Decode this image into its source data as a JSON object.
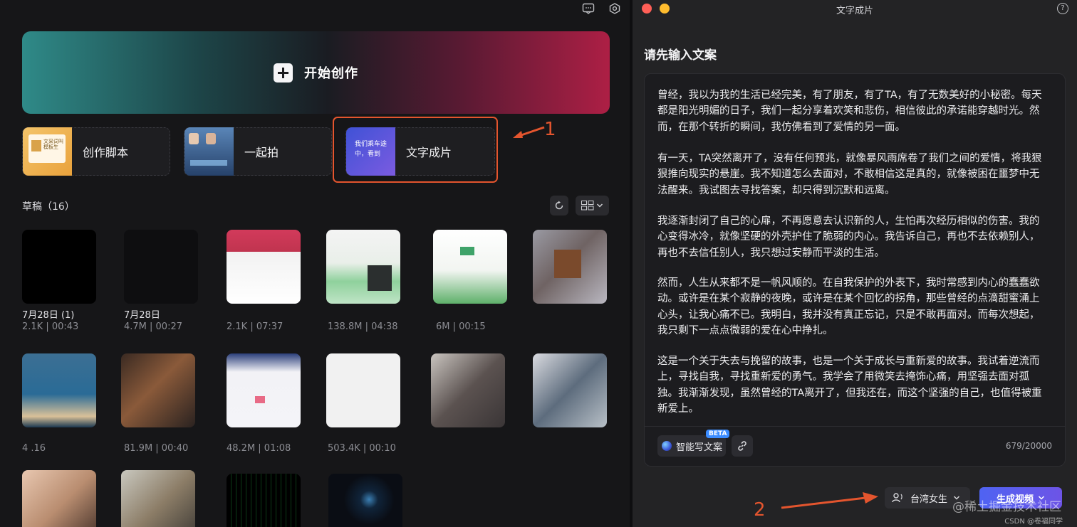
{
  "left": {
    "hero_label": "开始创作",
    "features": [
      {
        "label": "创作脚本",
        "thumb_text": "文采词叫 模板生"
      },
      {
        "label": "一起拍"
      },
      {
        "label": "文字成片",
        "thumb_text": "我们乘车途中，看到"
      }
    ],
    "annotation_1": "1",
    "drafts_title": "草稿（16）",
    "drafts": [
      {
        "name": "7月28日 (1)",
        "meta": "2.1K | 00:43"
      },
      {
        "name": "7月28日",
        "meta": "4.7M | 00:27"
      },
      {
        "name": "",
        "meta": "2.1K | 07:37"
      },
      {
        "name": "",
        "meta": "138.8M | 04:38"
      },
      {
        "name": "",
        "meta": "6M | 00:15"
      },
      {
        "name": "",
        "meta": ""
      },
      {
        "name": "",
        "meta": "4 .16"
      },
      {
        "name": "",
        "meta": "81.9M | 00:40"
      },
      {
        "name": "",
        "meta": "48.2M | 01:08"
      },
      {
        "name": "",
        "meta": "503.4K | 00:10"
      },
      {
        "name": "",
        "meta": ""
      },
      {
        "name": "",
        "meta": ""
      }
    ]
  },
  "right": {
    "window_title": "文字成片",
    "help": "?",
    "prompt_title": "请先输入文案",
    "paragraphs": [
      "曾经，我以为我的生活已经完美，有了朋友，有了TA，有了无数美好的小秘密。每天都是阳光明媚的日子，我们一起分享着欢笑和悲伤，相信彼此的承诺能穿越时光。然而，在那个转折的瞬间，我仿佛看到了爱情的另一面。",
      "有一天，TA突然离开了，没有任何预兆，就像暴风雨席卷了我们之间的爱情，将我狠狠推向现实的悬崖。我不知道怎么去面对，不敢相信这是真的，就像被困在噩梦中无法醒来。我试图去寻找答案，却只得到沉默和远离。",
      "我逐渐封闭了自己的心扉，不再愿意去认识新的人，生怕再次经历相似的伤害。我的心变得冰冷，就像坚硬的外壳护住了脆弱的内心。我告诉自己，再也不去依赖别人，再也不去信任别人，我只想过安静而平淡的生活。",
      "然而，人生从来都不是一帆风顺的。在自我保护的外表下，我时常感到内心的蠢蠢欲动。或许是在某个寂静的夜晚，或许是在某个回忆的拐角，那些曾经的点滴甜蜜涌上心头，让我心痛不已。我明白，我并没有真正忘记，只是不敢再面对。而每次想起，我只剩下一点点微弱的爱在心中挣扎。",
      "这是一个关于失去与挽留的故事，也是一个关于成长与重新爱的故事。我试着逆流而上，寻找自我，寻找重新爱的勇气。我学会了用微笑去掩饰心痛，用坚强去面对孤独。我渐渐发现，虽然曾经的TA离开了，但我还在，而这个坚强的自己，也值得被重新爱上。"
    ],
    "ai_button": "智能写文案",
    "beta_badge": "BETA",
    "counter": "679/20000",
    "voice_label": "台湾女生",
    "generate_label": "生成视频",
    "annotation_2": "2",
    "watermark": "@稀土掘金技术社区",
    "credit": "CSDN @卷福同学"
  },
  "colors": {
    "accent_red": "#e4552e",
    "generate_blue": "#4f63f2",
    "background": "#161618"
  }
}
